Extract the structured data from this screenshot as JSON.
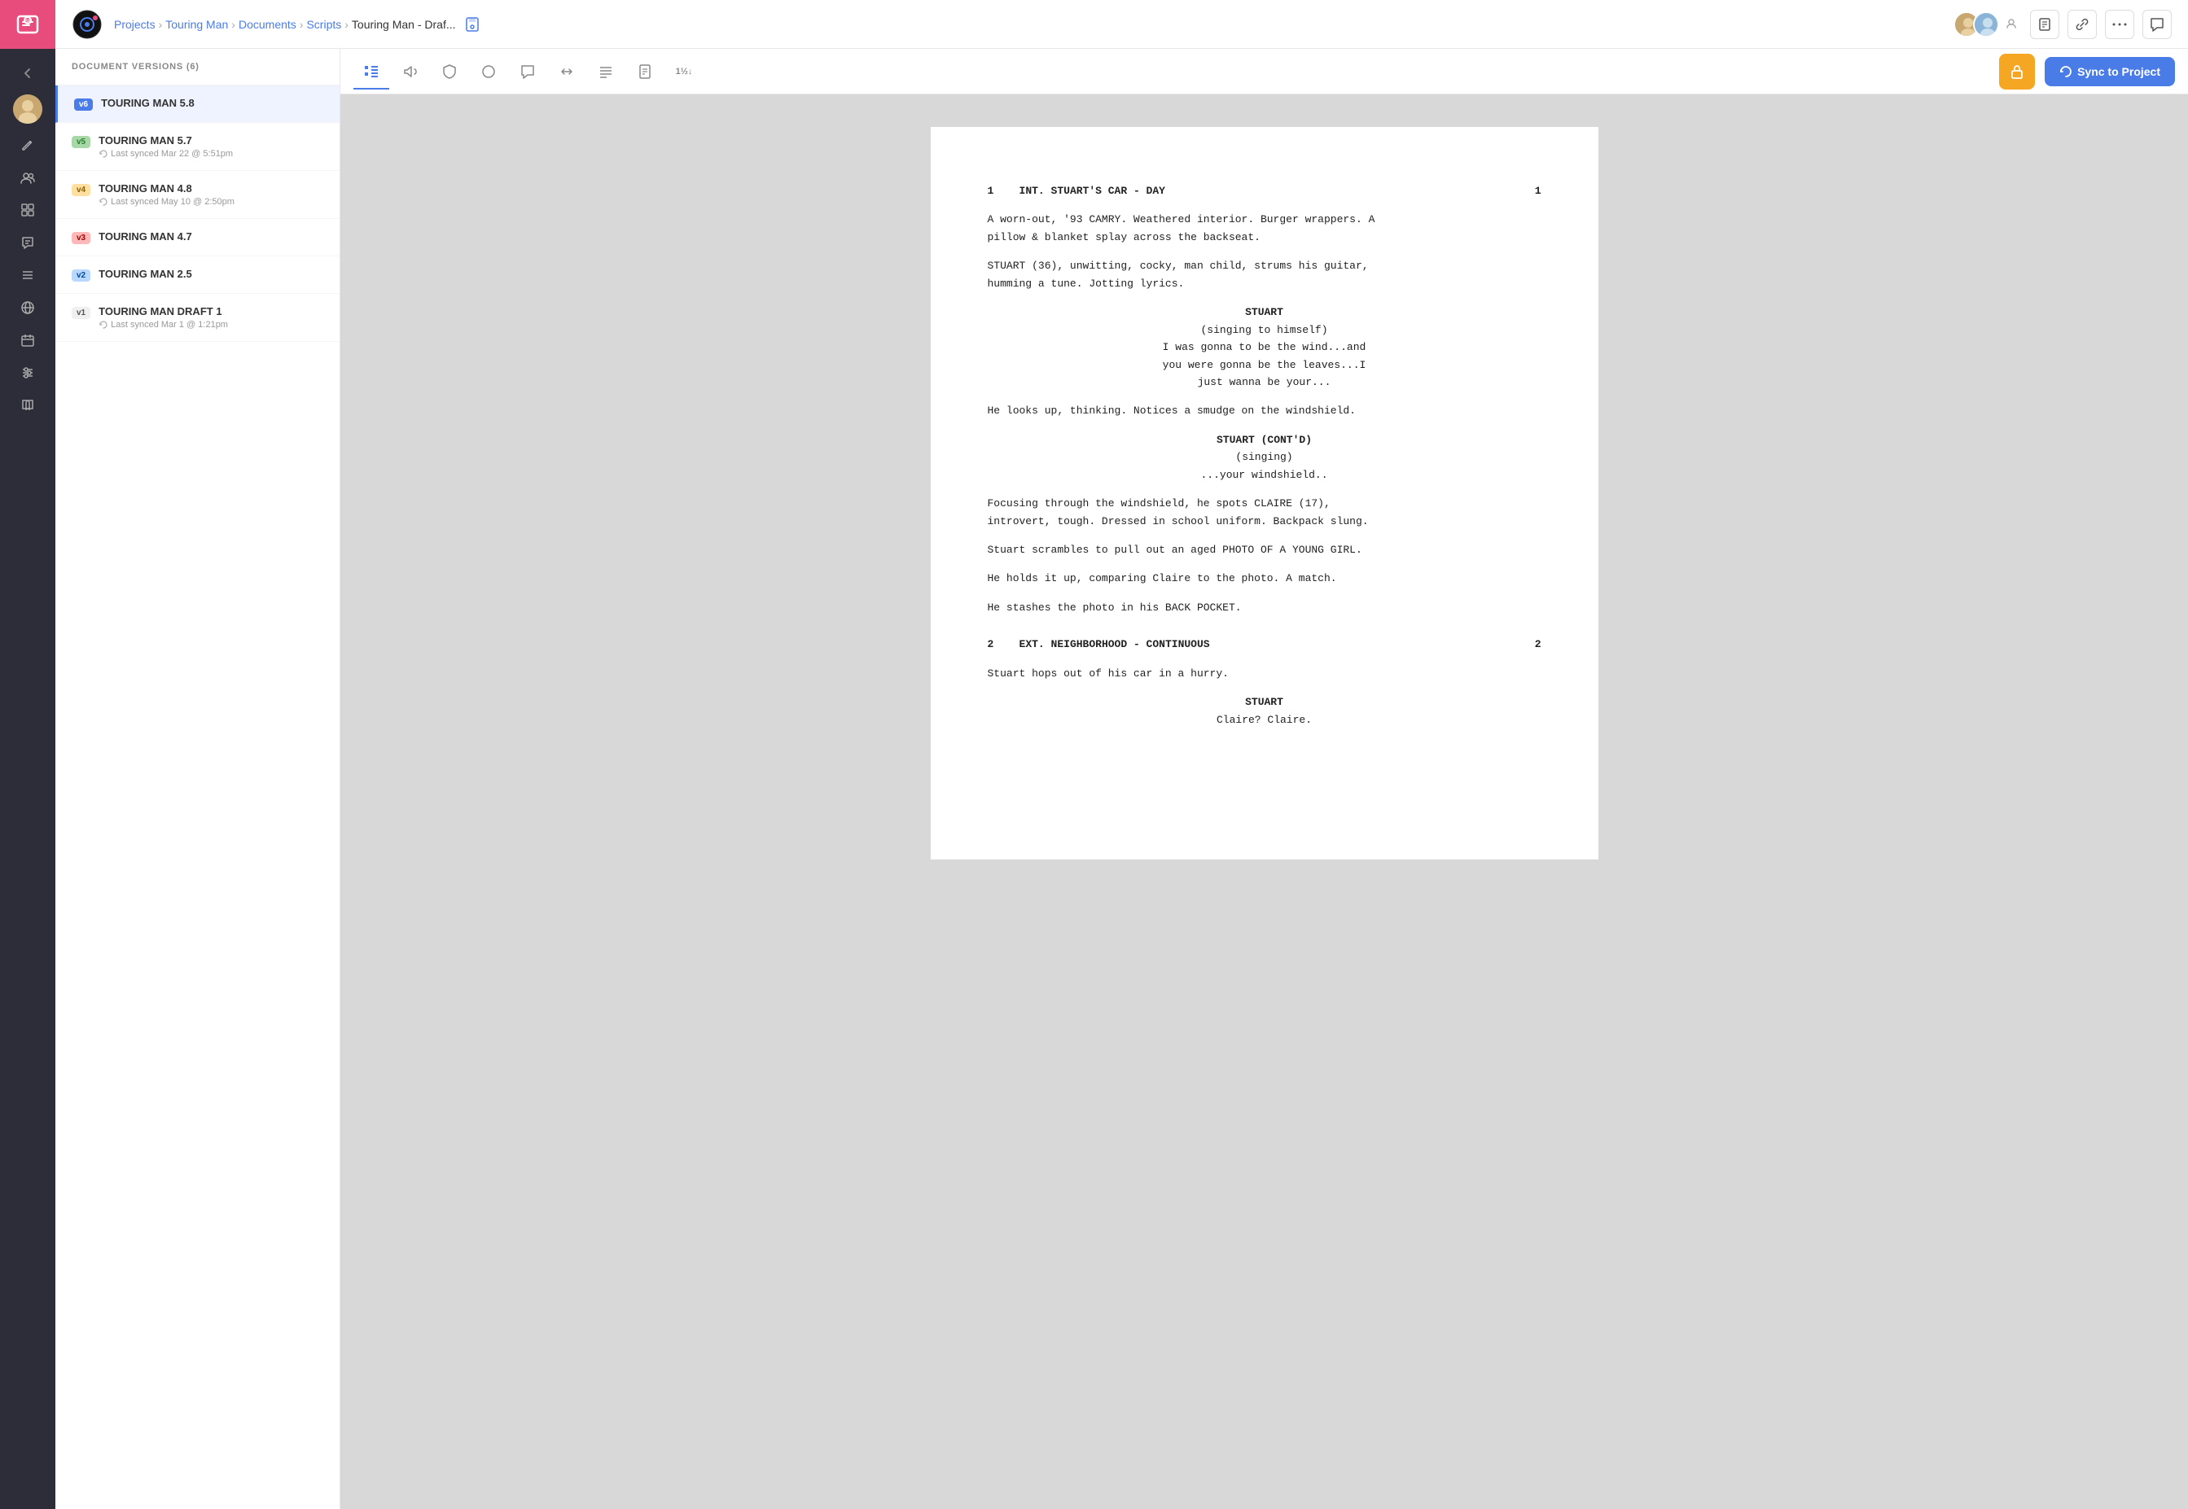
{
  "app": {
    "logo_alt": "StudioBinder",
    "top_icon_color": "#e84c7d"
  },
  "breadcrumb": {
    "projects": "Projects",
    "touring_man": "Touring Man",
    "documents": "Documents",
    "scripts": "Scripts",
    "current": "Touring Man - Draf..."
  },
  "sidebar": {
    "header": "Document Versions (6)",
    "versions": [
      {
        "badge": "v6",
        "badge_class": "v6-badge",
        "name": "TOURING MAN 5.8",
        "sync": "",
        "active": true
      },
      {
        "badge": "v5",
        "badge_class": "v5-badge",
        "name": "TOURING MAN 5.7",
        "sync": "Last synced Mar 22 @ 5:51pm",
        "active": false
      },
      {
        "badge": "v4",
        "badge_class": "v4-badge",
        "name": "TOURING MAN 4.8",
        "sync": "Last synced May 10 @ 2:50pm",
        "active": false
      },
      {
        "badge": "v3",
        "badge_class": "v3-badge",
        "name": "TOURING MAN 4.7",
        "sync": "",
        "active": false
      },
      {
        "badge": "v2",
        "badge_class": "v2-badge",
        "name": "TOURING MAN 2.5",
        "sync": "",
        "active": false
      },
      {
        "badge": "v1",
        "badge_class": "v1-badge",
        "name": "TOURING MAN DRAFT 1",
        "sync": "Last synced Mar 1 @ 1:21pm",
        "active": false
      }
    ]
  },
  "toolbar": {
    "sync_label": "Sync to Project",
    "icons": [
      "scenes",
      "megaphone",
      "shield",
      "circle",
      "chat",
      "arrows",
      "lines",
      "doc",
      "number"
    ]
  },
  "script": {
    "scenes": [
      {
        "num": "1",
        "heading": "INT. STUART'S CAR - DAY",
        "action": [
          "A worn-out, '93 CAMRY. Weathered interior. Burger wrappers. A\npillow & blanket splay across the backseat.",
          "STUART (36), unwitting, cocky, man child, strums his guitar,\nhumming a tune. Jotting lyrics."
        ],
        "dialogue_blocks": [
          {
            "character": "STUART",
            "parenthetical": "(singing to himself)",
            "lines": "I was gonna to be the wind...and\nyou were gonna be the leaves...I\njust wanna be your..."
          }
        ],
        "action2": [
          "He looks up, thinking. Notices a smudge on the windshield."
        ],
        "dialogue_blocks2": [
          {
            "character": "STUART (CONT'D)",
            "parenthetical": "(singing)",
            "lines": "...your windshield.."
          }
        ],
        "action3": [
          "Focusing through the windshield, he spots CLAIRE (17),\nintrovert, tough. Dressed in school uniform. Backpack slung.",
          "Stuart scrambles to pull out an aged PHOTO OF A YOUNG GIRL.",
          "He holds it up, comparing Claire to the photo. A match.",
          "He stashes the photo in his BACK POCKET."
        ]
      },
      {
        "num": "2",
        "heading": "EXT. NEIGHBORHOOD - CONTINUOUS",
        "action": [
          "Stuart hops out of his car in a hurry."
        ],
        "dialogue_blocks": [
          {
            "character": "STUART",
            "parenthetical": "",
            "lines": "Claire? Claire."
          }
        ],
        "action2": [],
        "dialogue_blocks2": [],
        "action3": []
      }
    ]
  },
  "nav_sidebar_icons": [
    {
      "name": "back-arrow-icon",
      "symbol": "←"
    },
    {
      "name": "user-avatar-icon",
      "symbol": "👤"
    },
    {
      "name": "edit-icon",
      "symbol": "✏️"
    },
    {
      "name": "people-icon",
      "symbol": "👥"
    },
    {
      "name": "boards-icon",
      "symbol": "⊞"
    },
    {
      "name": "comments-icon",
      "symbol": "≡"
    },
    {
      "name": "list-icon",
      "symbol": "☰"
    },
    {
      "name": "globe-icon",
      "symbol": "⊕"
    },
    {
      "name": "calendar-icon",
      "symbol": "📅"
    },
    {
      "name": "sliders-icon",
      "symbol": "⊟"
    },
    {
      "name": "book-icon",
      "symbol": "📖"
    }
  ]
}
